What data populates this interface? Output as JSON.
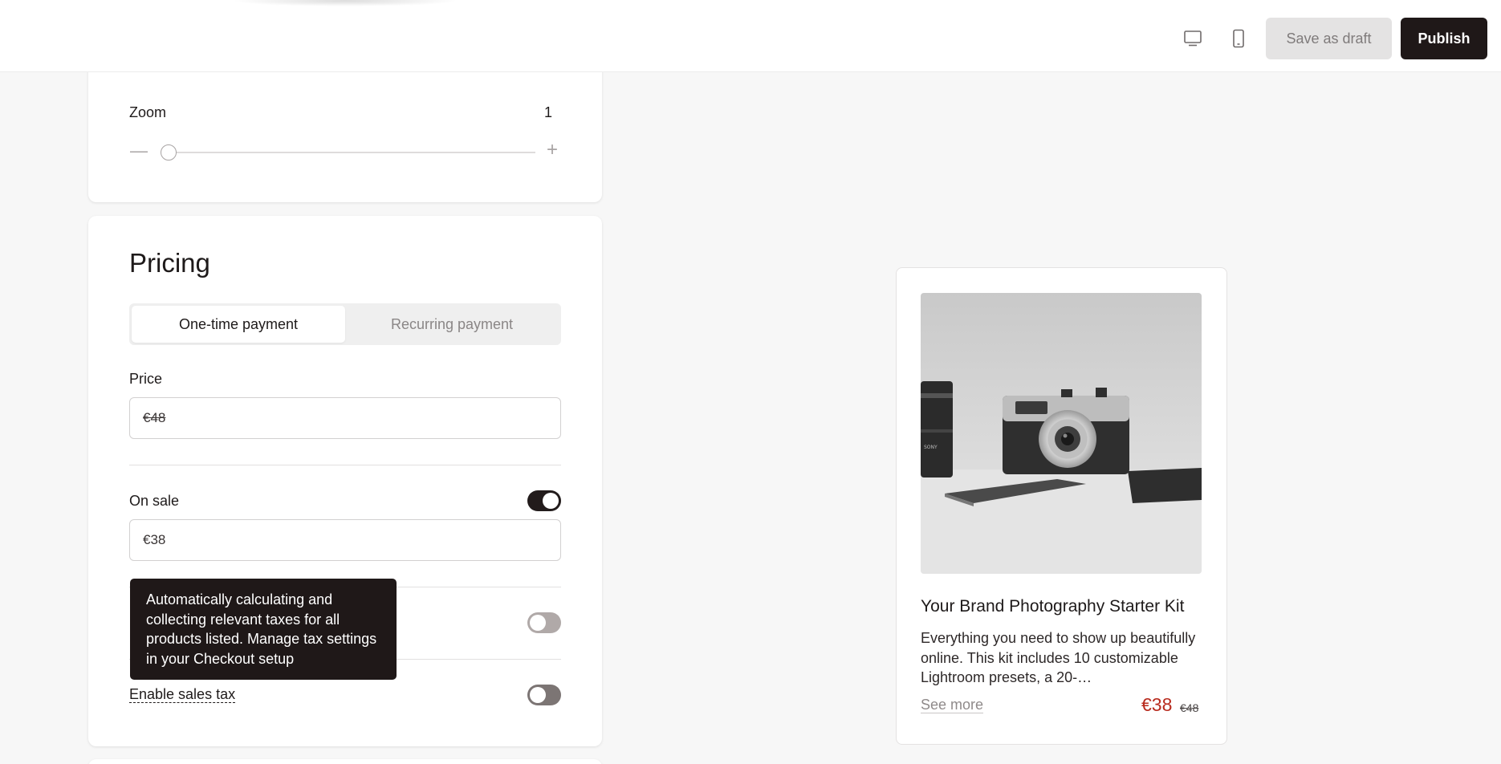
{
  "header": {
    "desktop_icon": "desktop-icon",
    "mobile_icon": "mobile-icon",
    "save_draft_label": "Save as draft",
    "publish_label": "Publish"
  },
  "zoom": {
    "label": "Zoom",
    "value": "1",
    "slider_fraction": 0.0,
    "minus_icon": "minus-icon",
    "plus_icon": "plus-icon"
  },
  "pricing": {
    "title": "Pricing",
    "tabs": [
      {
        "label": "One-time payment",
        "active": true
      },
      {
        "label": "Recurring payment",
        "active": false
      }
    ],
    "price_label": "Price",
    "price_value": "€48",
    "on_sale_label": "On sale",
    "on_sale_enabled": true,
    "sale_price_value": "€38",
    "tooltip_text": "Automatically calculating and collecting relevant taxes for all products listed. Manage tax settings in your Checkout setup",
    "auto_tax_enabled": false,
    "sales_tax_label": "Enable sales tax",
    "sales_tax_enabled": false
  },
  "preview": {
    "title": "Your Brand Photography Starter Kit",
    "description": "Everything you need to show up beautifully online. This kit includes 10 customizable Lightroom presets, a 20-…",
    "see_more": "See more",
    "sale_price": "€38",
    "original_price": "€48",
    "image_icon": "camera-photo"
  },
  "colors": {
    "primary": "#1f1818",
    "sale_red": "#b82b1e",
    "background": "#f7f7f7"
  }
}
